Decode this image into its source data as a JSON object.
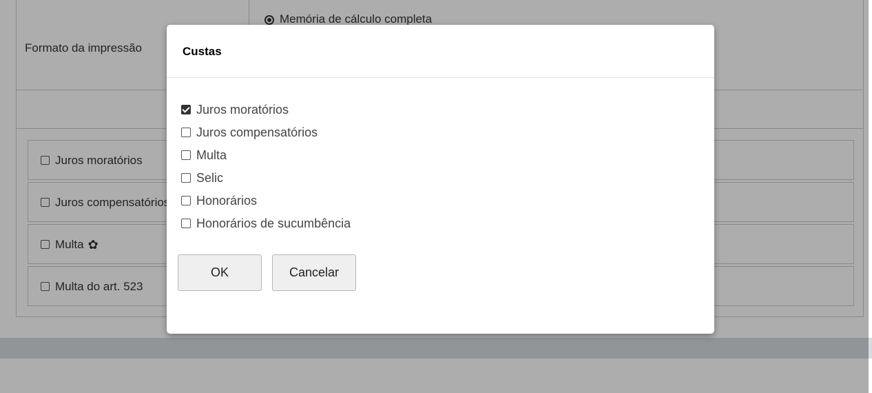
{
  "background": {
    "format_label": "Formato da impressão",
    "format_option": "Memória de cálculo completa",
    "options": [
      {
        "label": "Juros moratórios",
        "checked": false,
        "has_gear": false
      },
      {
        "label": "Juros compensatórios",
        "checked": false,
        "has_gear": false
      },
      {
        "label": "Multa",
        "checked": false,
        "has_gear": true
      },
      {
        "label": "Multa do art. 523",
        "checked": false,
        "has_gear": false
      }
    ]
  },
  "modal": {
    "title": "Custas",
    "items": [
      {
        "label": "Juros moratórios",
        "checked": true
      },
      {
        "label": "Juros compensatórios",
        "checked": false
      },
      {
        "label": "Multa",
        "checked": false
      },
      {
        "label": "Selic",
        "checked": false
      },
      {
        "label": "Honorários",
        "checked": false
      },
      {
        "label": "Honorários de sucumbência",
        "checked": false
      }
    ],
    "ok_label": "OK",
    "cancel_label": "Cancelar"
  },
  "icons": {
    "gear": "gear-icon",
    "checkbox": "checkbox-icon",
    "radio": "radio-icon"
  }
}
